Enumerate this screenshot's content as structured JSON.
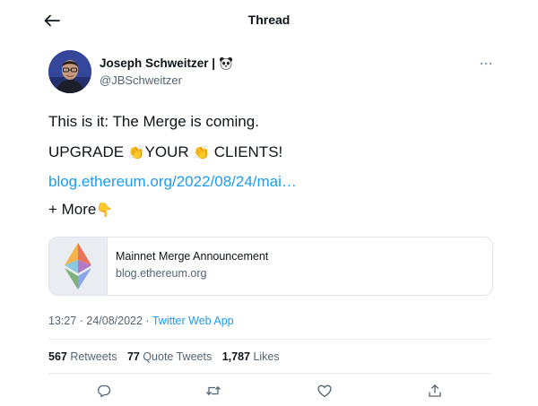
{
  "header": {
    "title": "Thread",
    "back_icon": "arrow-left-icon"
  },
  "author": {
    "name": "Joseph Schweitzer |",
    "handle": "@JBSchweitzer",
    "badge_icon": "panda-icon",
    "more_icon": "more-horizontal-icon"
  },
  "tweet": {
    "line1": "This is it: The Merge is coming.",
    "line2_parts": [
      "UPGRADE ",
      "👏",
      "YOUR ",
      "👏",
      " CLIENTS!"
    ],
    "link": "blog.ethereum.org/2022/08/24/mai…",
    "more": "+ More",
    "more_emoji": "👇"
  },
  "card": {
    "title": "Mainnet Merge Announcement",
    "domain": "blog.ethereum.org",
    "thumb_icon": "ethereum-logo-icon"
  },
  "meta": {
    "time": "13:27",
    "separator": " · ",
    "date": "24/08/2022",
    "source": "Twitter Web App"
  },
  "stats": {
    "retweets_count": "567",
    "retweets_label": " Retweets",
    "quotes_count": "77",
    "quotes_label": " Quote Tweets",
    "likes_count": "1,787",
    "likes_label": " Likes"
  },
  "actions": {
    "reply_icon": "reply-icon",
    "retweet_icon": "retweet-icon",
    "like_icon": "heart-icon",
    "share_icon": "share-icon"
  },
  "colors": {
    "link": "#1d9bf0",
    "secondary_text": "#536471",
    "primary_text": "#0f1419"
  }
}
